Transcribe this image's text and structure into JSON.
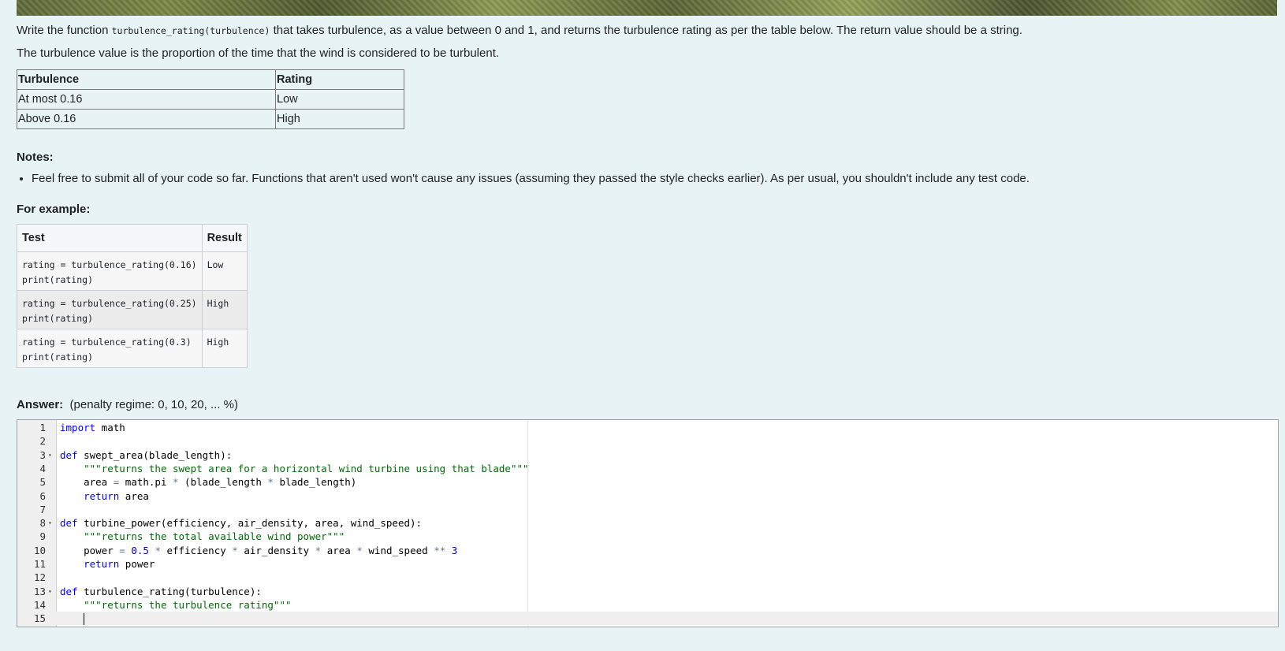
{
  "intro": {
    "text1a": "Write the function ",
    "func_sig": "turbulence_rating(turbulence)",
    "text1b": " that takes turbulence, as a value between 0 and 1, and returns the turbulence rating as per the table below. The return value should be a string.",
    "text2": "The turbulence value is the proportion of the time that the wind is considered to be turbulent."
  },
  "rating_table": {
    "headers": [
      "Turbulence",
      "Rating"
    ],
    "rows": [
      [
        "At most 0.16",
        "Low"
      ],
      [
        "Above 0.16",
        "High"
      ]
    ]
  },
  "notes": {
    "heading": "Notes:",
    "items": [
      "Feel free to submit all of your code so far. Functions that aren't used won't cause any issues (assuming they passed the style checks earlier). As per usual, you shouldn't include any test code."
    ]
  },
  "example": {
    "heading": "For example:",
    "headers": [
      "Test",
      "Result"
    ],
    "rows": [
      {
        "test": "rating = turbulence_rating(0.16)\nprint(rating)",
        "result": "Low"
      },
      {
        "test": "rating = turbulence_rating(0.25)\nprint(rating)",
        "result": "High"
      },
      {
        "test": "rating = turbulence_rating(0.3)\nprint(rating)",
        "result": "High"
      }
    ]
  },
  "answer": {
    "label": "Answer:",
    "penalty": "(penalty regime: 0, 10, 20, ... %)"
  },
  "editor": {
    "lines": [
      {
        "n": "1",
        "fold": false,
        "html": "<span class=\"kw\">import</span> math"
      },
      {
        "n": "2",
        "fold": false,
        "html": ""
      },
      {
        "n": "3",
        "fold": true,
        "html": "<span class=\"kw\">def</span> swept_area(blade_length):"
      },
      {
        "n": "4",
        "fold": false,
        "html": "    <span class=\"str\">\"\"\"returns the swept area for a horizontal wind turbine using that blade\"\"\"</span>"
      },
      {
        "n": "5",
        "fold": false,
        "html": "    area <span class=\"op\">=</span> math.pi <span class=\"op\">*</span> (blade_length <span class=\"op\">*</span> blade_length)"
      },
      {
        "n": "6",
        "fold": false,
        "html": "    <span class=\"kw\">return</span> area"
      },
      {
        "n": "7",
        "fold": false,
        "html": ""
      },
      {
        "n": "8",
        "fold": true,
        "html": "<span class=\"kw\">def</span> turbine_power(efficiency, air_density, area, wind_speed):"
      },
      {
        "n": "9",
        "fold": false,
        "html": "    <span class=\"str\">\"\"\"returns the total available wind power\"\"\"</span>"
      },
      {
        "n": "10",
        "fold": false,
        "html": "    power <span class=\"op\">=</span> <span class=\"num\">0.5</span> <span class=\"op\">*</span> efficiency <span class=\"op\">*</span> air_density <span class=\"op\">*</span> area <span class=\"op\">*</span> wind_speed <span class=\"op\">**</span> <span class=\"num\">3</span>"
      },
      {
        "n": "11",
        "fold": false,
        "html": "    <span class=\"kw\">return</span> power"
      },
      {
        "n": "12",
        "fold": false,
        "html": ""
      },
      {
        "n": "13",
        "fold": true,
        "html": "<span class=\"kw\">def</span> turbulence_rating(turbulence):"
      },
      {
        "n": "14",
        "fold": false,
        "html": "    <span class=\"str\">\"\"\"returns the turbulence rating\"\"\"</span>"
      },
      {
        "n": "15",
        "fold": false,
        "html": "    <span class=\"cursor\"></span>"
      }
    ]
  }
}
